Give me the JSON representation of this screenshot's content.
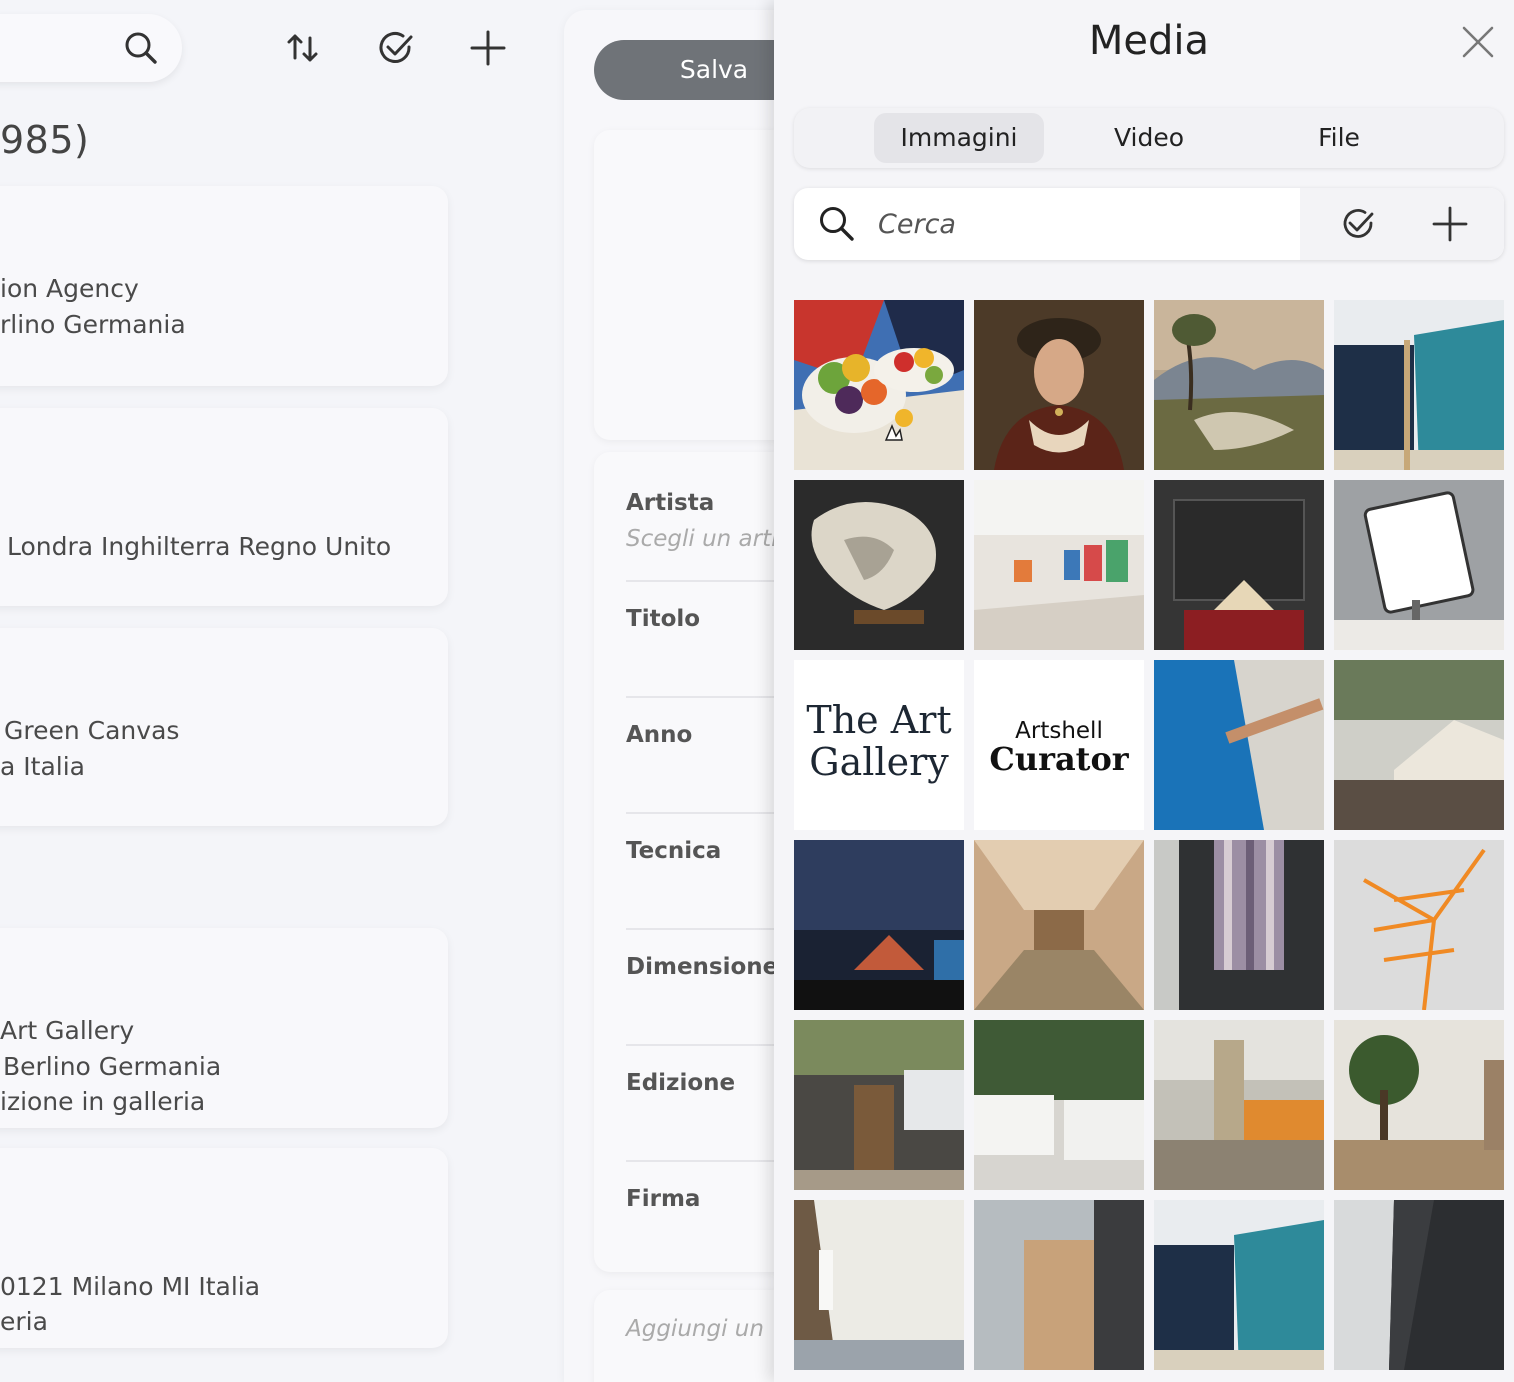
{
  "left_panel": {
    "heading": "985)",
    "cards": [
      {
        "lines": [
          "ion Agency",
          "rlino Germania"
        ]
      },
      {
        "lines": [
          "Londra Inghilterra Regno Unito"
        ]
      },
      {
        "lines": [
          "Green Canvas",
          "a Italia"
        ]
      },
      {
        "lines": [
          "Art Gallery",
          "Berlino Germania",
          "izione in galleria"
        ]
      },
      {
        "lines": [
          "0121 Milano MI Italia",
          "eria"
        ]
      }
    ]
  },
  "toolbar": {
    "icons": [
      "search-icon",
      "sort-icon",
      "check-circle-icon",
      "plus-icon"
    ]
  },
  "form": {
    "save_label": "Salva",
    "fields": [
      {
        "label": "Artista",
        "placeholder": "Scegli un arti"
      },
      {
        "label": "Titolo"
      },
      {
        "label": "Anno"
      },
      {
        "label": "Tecnica"
      },
      {
        "label": "Dimensione"
      },
      {
        "label": "Edizione"
      },
      {
        "label": "Firma"
      }
    ],
    "add_placeholder": "Aggiungi un"
  },
  "media": {
    "title": "Media",
    "tabs": [
      {
        "label": "Immagini",
        "active": true
      },
      {
        "label": "Video",
        "active": false
      },
      {
        "label": "File",
        "active": false
      }
    ],
    "search_placeholder": "Cerca",
    "logos": {
      "art_gallery_line1": "The Art",
      "art_gallery_line2": "Gallery",
      "curator_line1": "Artshell",
      "curator_line2": "Curator"
    },
    "thumbnails": [
      "cubist-fruit-bowl-painting",
      "portrait-woman-painting",
      "landscape-river-painting",
      "tarp-wall-photo",
      "driftwood-sculpture-photo",
      "gallery-interior-photo",
      "book-stand-photo",
      "tablet-menu-photo",
      "the-art-gallery-logo",
      "artshell-curator-logo",
      "blue-tarp-photo",
      "tent-camp-photo",
      "night-camp-photo",
      "unhcr-tent-interior-photo",
      "striped-fabric-photo",
      "orange-net-photo",
      "tent-door-photo",
      "white-containers-photo",
      "building-tower-photo",
      "tree-fence-photo",
      "tent-cloth-photo",
      "tarp-panel-photo",
      "tarp-wall-photo-2",
      "dark-fabric-photo"
    ]
  },
  "colors": {
    "background": "#f4f5f9",
    "save_button": "#6f7378",
    "active_tab": "#e4e4e8"
  }
}
